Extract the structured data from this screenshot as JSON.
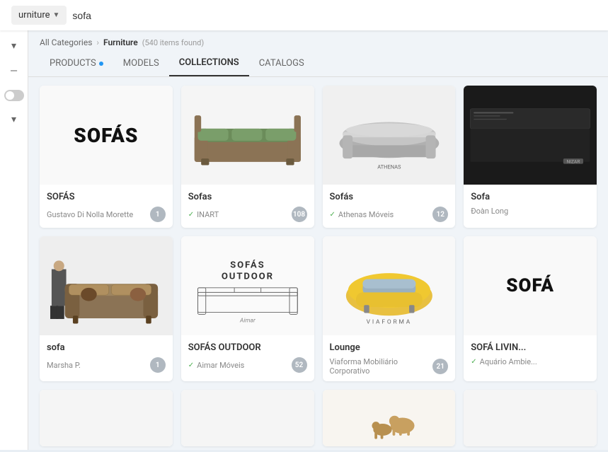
{
  "topbar": {
    "dropdown_label": "urniture",
    "search_value": "sofa"
  },
  "breadcrumb": {
    "all_categories": "All Categories",
    "separator": "›",
    "current": "Furniture",
    "count": "(540 items found)"
  },
  "tabs": [
    {
      "id": "products",
      "label": "PRODUCTS",
      "dot": true,
      "active": false
    },
    {
      "id": "models",
      "label": "MODELS",
      "dot": false,
      "active": false
    },
    {
      "id": "collections",
      "label": "COLLECTIONS",
      "dot": false,
      "active": true
    },
    {
      "id": "catalogs",
      "label": "CATALOGS",
      "dot": false,
      "active": false
    }
  ],
  "cards": [
    {
      "id": "card-sofas-1",
      "title": "SOFÁS",
      "author": "Gustavo Di Nolla Morette",
      "verified": false,
      "count": "1",
      "image_type": "text",
      "image_text": "SOFÁS"
    },
    {
      "id": "card-sofas-inart",
      "title": "Sofas",
      "author": "INART",
      "verified": true,
      "count": "108",
      "image_type": "sofa-green",
      "image_text": ""
    },
    {
      "id": "card-sofas-athenas",
      "title": "Sofás",
      "author": "Athenas Móveis",
      "verified": true,
      "count": "12",
      "image_type": "sofa-grey-curved",
      "image_text": ""
    },
    {
      "id": "card-sofa-doan",
      "title": "Sofa",
      "author": "Đoàn Long",
      "verified": false,
      "count": "",
      "image_type": "dark",
      "image_text": ""
    },
    {
      "id": "card-sofa-marsha",
      "title": "sofa",
      "author": "Marsha P.",
      "verified": false,
      "count": "1",
      "image_type": "sofa-vintage",
      "image_text": ""
    },
    {
      "id": "card-sofas-outdoor",
      "title": "SOFÁS OUTDOOR",
      "author": "Aimar Móveis",
      "verified": true,
      "count": "52",
      "image_type": "outdoor-sketch",
      "image_text": "SOFÁS\nOUTDOOR"
    },
    {
      "id": "card-lounge",
      "title": "Lounge",
      "author": "Viaforma Mobiliário Corporativo",
      "verified": false,
      "count": "21",
      "image_type": "viaforma",
      "image_text": ""
    },
    {
      "id": "card-sofa-living",
      "title": "SOFÁ LIVIN...",
      "author": "Aquário Ambie...",
      "verified": true,
      "count": "",
      "image_type": "sofa-living-text",
      "image_text": "SOFÁ"
    }
  ],
  "bottom_cards": [
    {
      "id": "bc1",
      "image_type": "empty"
    },
    {
      "id": "bc2",
      "image_type": "empty"
    },
    {
      "id": "bc3",
      "image_type": "dogs"
    },
    {
      "id": "bc4",
      "image_type": "empty"
    }
  ]
}
